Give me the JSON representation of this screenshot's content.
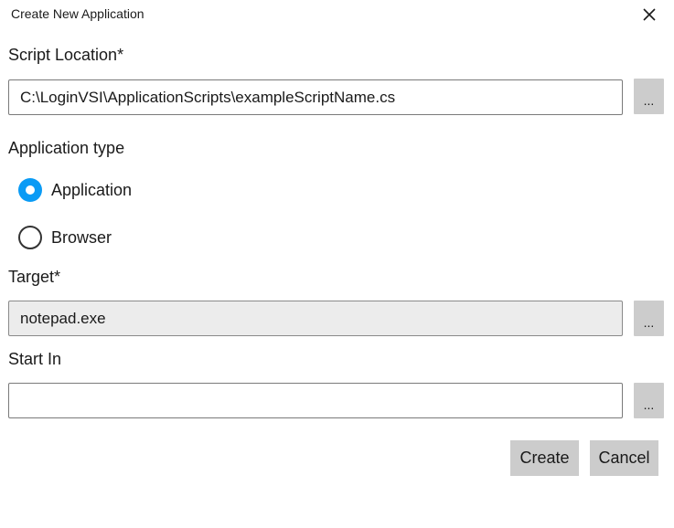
{
  "window": {
    "title": "Create New Application"
  },
  "script_location": {
    "label": "Script Location*",
    "value": "C:\\LoginVSI\\ApplicationScripts\\exampleScriptName.cs",
    "browse_label": "..."
  },
  "application_type": {
    "label": "Application type",
    "options": [
      {
        "label": "Application",
        "selected": true
      },
      {
        "label": "Browser",
        "selected": false
      }
    ]
  },
  "target": {
    "label": "Target*",
    "value": "notepad.exe",
    "browse_label": "..."
  },
  "start_in": {
    "label": "Start In",
    "value": "",
    "browse_label": "..."
  },
  "actions": {
    "create_label": "Create",
    "cancel_label": "Cancel"
  },
  "colors": {
    "accent": "#0a9bf5",
    "button_bg": "#cccccc",
    "readonly_bg": "#ececec"
  },
  "icons": {
    "close": "close-icon"
  }
}
